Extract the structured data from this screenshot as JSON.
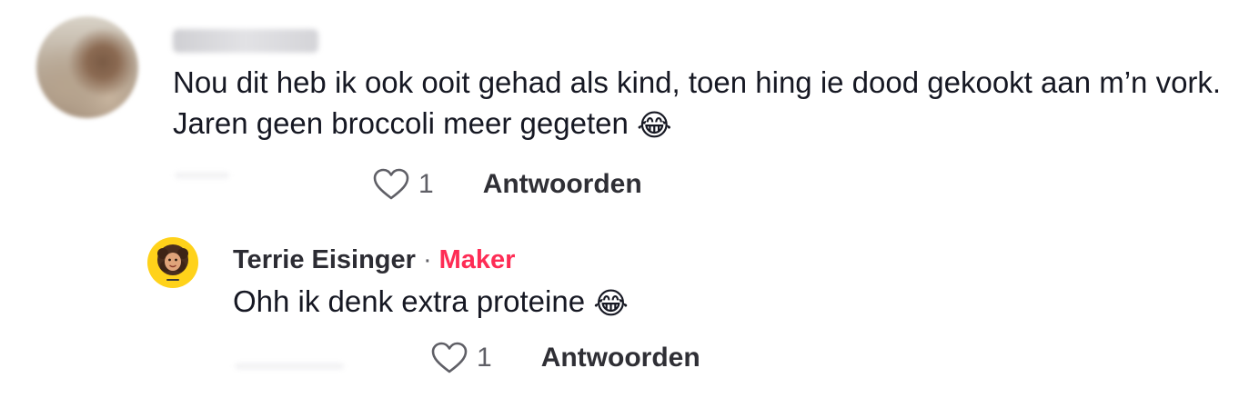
{
  "comment": {
    "text": "Nou dit heb ik ook ooit gehad als kind, toen hing ie dood gekookt aan m’n vork. Jaren geen broccoli meer gegeten",
    "emoji": "😂",
    "likes": "1",
    "reply_label": "Antwoorden"
  },
  "reply": {
    "author": "Terrie Eisinger",
    "separator": "·",
    "badge": "Maker",
    "text": "Ohh ik denk extra proteine",
    "emoji": "😂",
    "likes": "1",
    "reply_label": "Antwoorden"
  },
  "colors": {
    "badge": "#fe2c55",
    "text": "#161823",
    "secondary": "#5f5f66"
  },
  "icons": {
    "like": "heart-outline-icon"
  }
}
